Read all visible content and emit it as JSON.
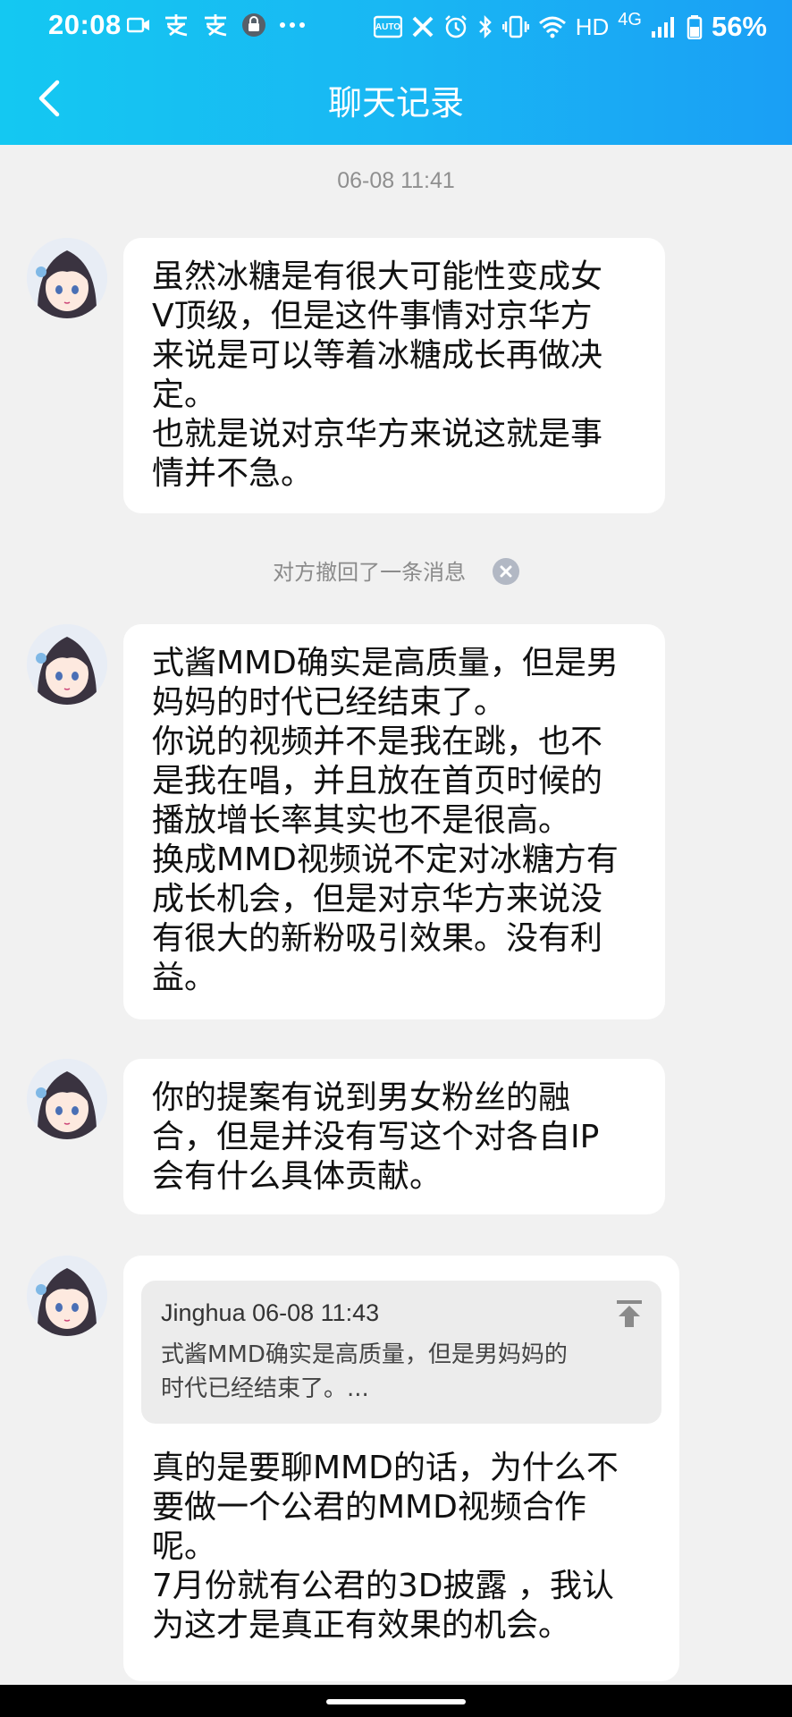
{
  "status_bar": {
    "time": "20:08",
    "battery": "56%",
    "network": "HD",
    "signal": "4G"
  },
  "header": {
    "title": "聊天记录"
  },
  "timestamp": "06-08 11:41",
  "messages": [
    {
      "lines": [
        "虽然冰糖是有很大可能性变成女",
        "V顶级，但是这件事情对京华方",
        "来说是可以等着冰糖成长再做决",
        "定。",
        "也就是说对京华方来说这就是事",
        "情并不急。"
      ]
    },
    {
      "lines": [
        "式酱MMD确实是高质量，但是男",
        "妈妈的时代已经结束了。",
        "你说的视频并不是我在跳，也不",
        "是我在唱，并且放在首页时候的",
        "播放增长率其实也不是很高。",
        "换成MMD视频说不定对冰糖方有",
        "成长机会，但是对京华方来说没",
        "有很大的新粉吸引效果。没有利",
        "益。"
      ]
    },
    {
      "lines": [
        "你的提案有说到男女粉丝的融",
        "合，但是并没有写这个对各自IP",
        "会有什么具体贡献。"
      ]
    },
    {
      "quote": {
        "header": "Jinghua 06-08 11:43",
        "lines": [
          "式酱MMD确实是高质量，但是男妈妈的",
          "时代已经结束了。..."
        ]
      },
      "lines": [
        "真的是要聊MMD的话，为什么不",
        "要做一个公君的MMD视频合作",
        "呢。",
        "7月份就有公君的3D披露 ，我认",
        "为这才是真正有效果的机会。"
      ]
    }
  ],
  "recall_notice": "对方撤回了一条消息"
}
